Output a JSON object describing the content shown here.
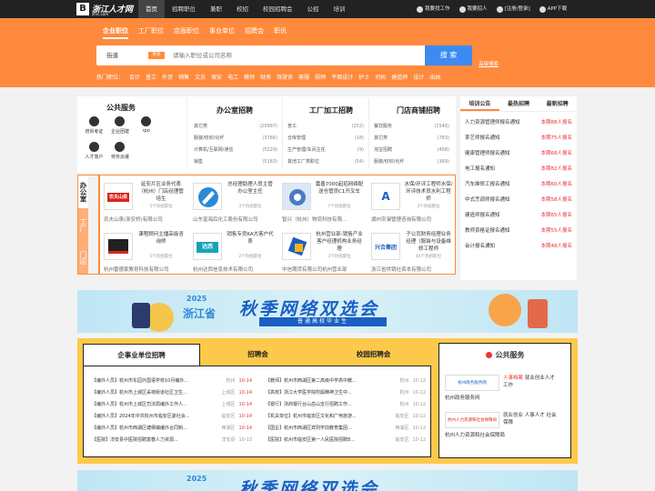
{
  "header": {
    "logo_main": "浙江人才网",
    "logo_sub": "zhrc.com",
    "nav": [
      "首页",
      "招聘职位",
      "兼职",
      "校招",
      "校园招聘会",
      "公招",
      "培训"
    ],
    "right": [
      "我要找工作",
      "我要招人",
      "[注册/登录]",
      "APP下载"
    ]
  },
  "search": {
    "tabs": [
      "企业职位",
      "工厂职位",
      "店面职位",
      "事业单位",
      "招聘会",
      "职讯"
    ],
    "location": "街道",
    "location_btn": "更多",
    "placeholder": "请输入职位或公司名称",
    "button": "搜 索",
    "advanced": "高级搜索",
    "hot_label": "热门职位：",
    "hot": [
      "会计",
      "普工",
      "外贸",
      "销售",
      "文员",
      "保安",
      "电工",
      "教师",
      "财务",
      "驾驶员",
      "客服",
      "厨师",
      "平面设计",
      "护士",
      "司机",
      "建造师",
      "设计",
      "出纳"
    ]
  },
  "public_service": {
    "title": "公共服务",
    "items": [
      "培训考证",
      "企业团建",
      "rpo",
      "人才落户",
      "劳务派遣"
    ]
  },
  "categories": [
    {
      "title": "办公室招聘",
      "rows": [
        [
          "其它类",
          "(20997)"
        ],
        [
          "服装/纺织/化纤",
          "(3766)"
        ],
        [
          "计算机/互联网/通信",
          "(5229)"
        ],
        [
          "销售",
          "(5163)"
        ]
      ]
    },
    {
      "title": "工厂加工招聘",
      "rows": [
        [
          "普工",
          "(252)"
        ],
        [
          "仓库管理",
          "(18)"
        ],
        [
          "生产管理/车间主任",
          "(9)"
        ],
        [
          "其他工厂类职位",
          "(54)"
        ]
      ]
    },
    {
      "title": "门店商铺招聘",
      "rows": [
        [
          "餐饮服务",
          "(1546)"
        ],
        [
          "其它类",
          "(783)"
        ],
        [
          "淘宝招聘",
          "(468)"
        ],
        [
          "服装/纺织/化纤",
          "(369)"
        ]
      ]
    }
  ],
  "side_tabs": [
    "办公室",
    "工厂",
    "门店"
  ],
  "companies": [
    {
      "logo": "农夫山泉",
      "desc": "延安片区业务代表（杭州）门店经理管培生",
      "count": "5个热招职位",
      "name": "农夫山泉(浙安桥)有限公司"
    },
    {
      "logo": "",
      "desc": "总经理助理人员主管办公室主任",
      "count": "3个热招职位",
      "name": "山东富海后化工股份有限公司"
    },
    {
      "logo": "",
      "desc": "嘉善7000起招网络配送仓管员C1开叉车",
      "count": "7个热招职位",
      "name": "智兴（杭州）物流科技有限..."
    },
    {
      "logo": "A",
      "desc": "水保/环评工程师水保/环评技术员水利工程师",
      "count": "3个热招职位",
      "name": "湖州安澜管理咨询有限公司"
    },
    {
      "logo": "",
      "desc": "课程顾问主播高级咨询师",
      "count": "5个热招职位",
      "name": "杭州雷德家教育科技有限公司"
    },
    {
      "logo": "达西",
      "desc": "销售专员KA大客户代表",
      "count": "2个热招职位",
      "name": "杭州达西信息技术有限公司"
    },
    {
      "logo": "",
      "desc": "杭州营业部-销售产业客户经理机构业务经理",
      "count": "3个热招职位",
      "name": "中信期货有限公司杭州营业部"
    },
    {
      "logo": "兴合集团",
      "desc": "子公司财务经理业务经理（服装与设备维修工程师",
      "count": "44个热招职位",
      "name": "浙江省供销社资本有限公司"
    }
  ],
  "announcements": {
    "tabs": [
      "培训公告",
      "最热招聘",
      "最新招聘"
    ],
    "rows": [
      [
        "人力资源管理师报名通知",
        "本期88人报名"
      ],
      [
        "茶艺师报名通知",
        "本期75人报名"
      ],
      [
        "健康管理师报名通知",
        "本期68人报名"
      ],
      [
        "电工报名通知",
        "本期82人报名"
      ],
      [
        "汽车维修工报名通知",
        "本期60人报名"
      ],
      [
        "中式烹调师报名通知",
        "本期58人报名"
      ],
      [
        "建造师报名通知",
        "本期65人报名"
      ],
      [
        "教师资格证报名通知",
        "本期55人报名"
      ],
      [
        "会计报名通知",
        "本期48人报名"
      ]
    ]
  },
  "banner": {
    "year": "2025",
    "province": "浙江省",
    "main": "秋季网络双选会",
    "sub": "普通高校毕业生"
  },
  "jobs": {
    "tabs": [
      "企事业单位招聘",
      "招聘会",
      "校园招聘会"
    ],
    "left": [
      [
        "【编外人员】杭州市东园外国语学校10月编外...",
        "杭州",
        "10-14"
      ],
      [
        "【编外人员】杭州市上城区采荷街道社区卫生...",
        "上城区",
        "10-14"
      ],
      [
        "【编外人员】杭州市上城区司法局编外工作人...",
        "上城区",
        "10-14"
      ],
      [
        "【编外人员】2024年中共杭州市临安区委社会...",
        "临安区",
        "10-14"
      ],
      [
        "【编外人员】杭州市西湖区塘栖镇编外合同制...",
        "西湖区",
        "10-14"
      ],
      [
        "【医院】淳安县中医院招聘富春人力资源...",
        "淳安县",
        "10-13"
      ]
    ],
    "right": [
      [
        "【教师】杭州市西湖区第二高级中学高中教...",
        "杭州",
        "10-12"
      ],
      [
        "【高校】浙江大学医学院附属精神卫生中...",
        "杭州",
        "10-12"
      ],
      [
        "【银行】浙商银行台山岳山支行招聘工作...",
        "杭州",
        "10-12"
      ],
      [
        "【机关单位】杭州市临安区文化和广电旅游...",
        "临安区",
        "10-12"
      ],
      [
        "【国企】杭州市西湖区宾则学前教育集团...",
        "西湖区",
        "10-12"
      ],
      [
        "【医院】杭州市临安区第一人民医院招聘8...",
        "临安区",
        "10-12"
      ]
    ]
  },
  "services": {
    "title": "公共服务",
    "items": [
      {
        "logo": "杭州政务服务网",
        "text_red": "人事档案",
        "text": "就业创业人才工作",
        "name": "杭州政务服务网"
      },
      {
        "logo": "杭州人力资源和社会保障局",
        "text_red": "",
        "text": "就业创业 人事人才 社会保障",
        "name": "杭州人力资源和社会保障局"
      }
    ]
  },
  "colors": {
    "primary": "#ff8a3d",
    "dark": "#222222",
    "link": "#3d8bf2",
    "alert": "#e33333",
    "yellow": "#fdc94a"
  }
}
